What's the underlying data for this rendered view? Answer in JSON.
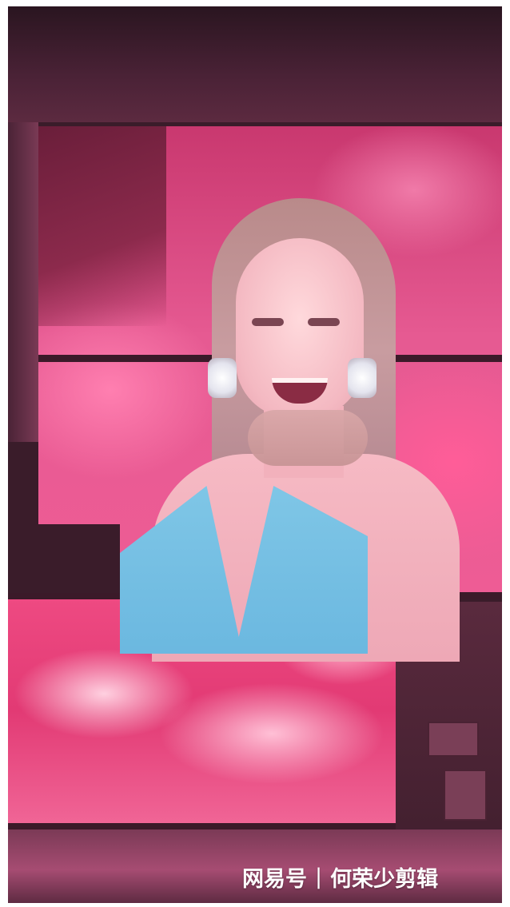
{
  "watermark": {
    "brand": "网易号",
    "separator": "|",
    "author": "何荣少剪辑"
  },
  "colors": {
    "screen_pink": "#e65a92",
    "lower_pink": "#e23a74",
    "stage_dark": "#3a1c2a",
    "dress_blue": "#7fc6e6"
  }
}
